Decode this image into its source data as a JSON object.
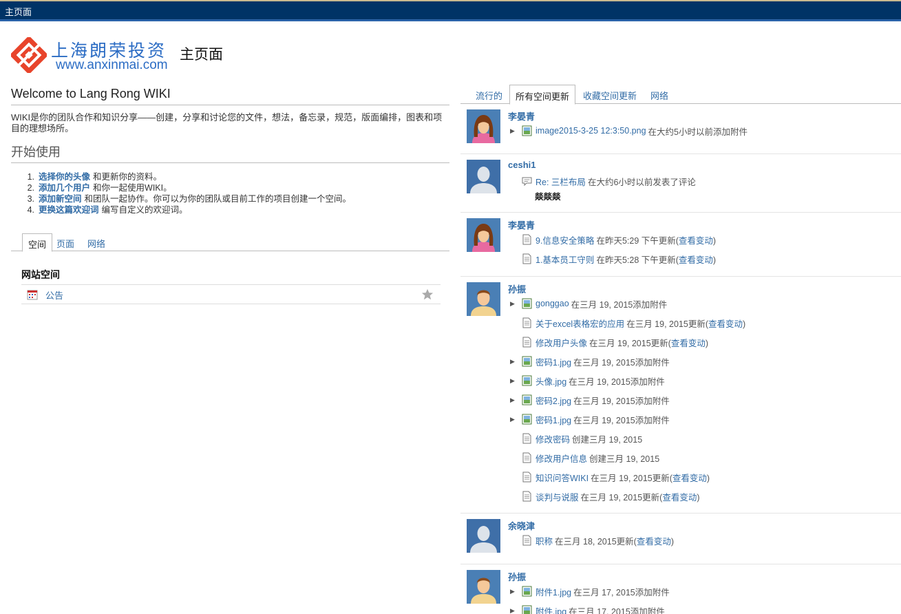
{
  "window": {
    "title": "主页面"
  },
  "logo": {
    "name_cn": "上海朗荣投资",
    "url_text": "www.anxinmai.com"
  },
  "page_title": "主页面",
  "welcome": {
    "title": "Welcome to Lang Rong WIKI",
    "description": "WIKI是你的团队合作和知识分享——创建，分享和讨论您的文件，想法，备忘录，规范，版面编排，图表和项目的理想场所。"
  },
  "getting_started": {
    "title": "开始使用",
    "steps": [
      {
        "num": "1.",
        "link": "选择你的头像",
        "text": "和更新你的资料。"
      },
      {
        "num": "2.",
        "link": "添加几个用户",
        "text": "和你一起使用WIKI。"
      },
      {
        "num": "3.",
        "link": "添加新空间",
        "text": "和团队一起协作。你可以为你的团队或目前工作的项目创建一个空间。"
      },
      {
        "num": "4.",
        "link": "更换这篇欢迎词",
        "text": "编写自定义的欢迎词。"
      }
    ]
  },
  "left_tabs": [
    "空间",
    "页面",
    "网络"
  ],
  "spaces": {
    "title": "网站空间",
    "items": [
      {
        "name": "公告",
        "icon": "calendar-icon",
        "fav_icon": "star-icon"
      }
    ]
  },
  "right_tabs": [
    "流行的",
    "所有空间更新",
    "收藏空间更新",
    "网络"
  ],
  "feed": [
    {
      "user": "李晏青",
      "avatar": "female-avatar",
      "items": [
        {
          "type": "image",
          "expand": true,
          "title": "image2015-3-25 12:3:50.png",
          "meta": "在大约5小时以前添加附件",
          "link": ""
        }
      ]
    },
    {
      "user": "ceshi1",
      "avatar": "default-avatar",
      "items": [
        {
          "type": "comment",
          "expand": false,
          "title": "Re: 三栏布局",
          "meta": "在大约6小时以前发表了评论",
          "link": ""
        }
      ],
      "comment": "燚燚燚"
    },
    {
      "user": "李晏青",
      "avatar": "female-avatar",
      "items": [
        {
          "type": "page",
          "expand": false,
          "title": "9.信息安全策略",
          "meta": "在昨天5:29 下午更新(",
          "link": "查看变动",
          "close": ")"
        },
        {
          "type": "page",
          "expand": false,
          "title": "1.基本员工守则",
          "meta": "在昨天5:28 下午更新(",
          "link": "查看变动",
          "close": ")"
        }
      ]
    },
    {
      "user": "孙振",
      "avatar": "male-avatar",
      "items": [
        {
          "type": "image",
          "expand": true,
          "title": "gonggao",
          "meta": "在三月 19, 2015添加附件",
          "link": ""
        },
        {
          "type": "page",
          "expand": false,
          "title": "关于excel表格宏的应用",
          "meta": "在三月 19, 2015更新(",
          "link": "查看变动",
          "close": ")"
        },
        {
          "type": "page",
          "expand": false,
          "title": "修改用户头像",
          "meta": "在三月 19, 2015更新(",
          "link": "查看变动",
          "close": ")"
        },
        {
          "type": "image",
          "expand": true,
          "title": "密码1.jpg",
          "meta": "在三月 19, 2015添加附件",
          "link": ""
        },
        {
          "type": "image",
          "expand": true,
          "title": "头像.jpg",
          "meta": "在三月 19, 2015添加附件",
          "link": ""
        },
        {
          "type": "image",
          "expand": true,
          "title": "密码2.jpg",
          "meta": "在三月 19, 2015添加附件",
          "link": ""
        },
        {
          "type": "image",
          "expand": true,
          "title": "密码1.jpg",
          "meta": "在三月 19, 2015添加附件",
          "link": ""
        },
        {
          "type": "page",
          "expand": false,
          "title": "修改密码",
          "meta": "创建三月 19, 2015",
          "link": ""
        },
        {
          "type": "page",
          "expand": false,
          "title": "修改用户信息",
          "meta": "创建三月 19, 2015",
          "link": ""
        },
        {
          "type": "page",
          "expand": false,
          "title": "知识问答WIKI",
          "meta": "在三月 19, 2015更新(",
          "link": "查看变动",
          "close": ")"
        },
        {
          "type": "page",
          "expand": false,
          "title": "谈判与说服",
          "meta": "在三月 19, 2015更新(",
          "link": "查看变动",
          "close": ")"
        }
      ]
    },
    {
      "user": "余晓津",
      "avatar": "default-avatar",
      "items": [
        {
          "type": "page",
          "expand": false,
          "title": "职称",
          "meta": "在三月 18, 2015更新(",
          "link": "查看变动",
          "close": ")"
        }
      ]
    },
    {
      "user": "孙振",
      "avatar": "male-avatar",
      "items": [
        {
          "type": "image",
          "expand": true,
          "title": "附件1.jpg",
          "meta": "在三月 17, 2015添加附件",
          "link": ""
        },
        {
          "type": "image",
          "expand": true,
          "title": "附件.jpg",
          "meta": "在三月 17, 2015添加附件",
          "link": ""
        }
      ]
    }
  ]
}
